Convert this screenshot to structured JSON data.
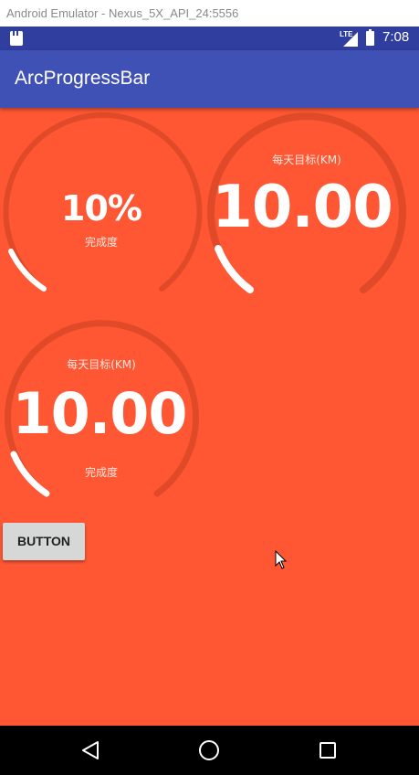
{
  "window": {
    "title": "Android Emulator - Nexus_5X_API_24:5556"
  },
  "status_bar": {
    "network": "LTE",
    "time": "7:08"
  },
  "app_bar": {
    "title": "ArcProgressBar"
  },
  "gauges": [
    {
      "value_text": "10%",
      "bottom_text": "完成度",
      "progress": 0.1
    },
    {
      "top_text": "每天目标(KM)",
      "value_text": "10.00",
      "progress": 0.1
    },
    {
      "top_text": "每天目标(KM)",
      "value_text": "10.00",
      "bottom_text": "完成度",
      "progress": 0.1
    }
  ],
  "button": {
    "label": "BUTTON"
  },
  "icons": {
    "status": [
      "sd-card-icon",
      "signal-icon",
      "battery-icon"
    ],
    "navigation": [
      "back-icon",
      "home-icon",
      "recents-icon"
    ],
    "pointer": "mouse-cursor-icon"
  },
  "colors": {
    "content_background": "#ff5733",
    "arc_track": "#e04a28",
    "arc_progress": "#ffffff",
    "app_bar": "#3f51b5",
    "status_bar": "#303f9f"
  }
}
